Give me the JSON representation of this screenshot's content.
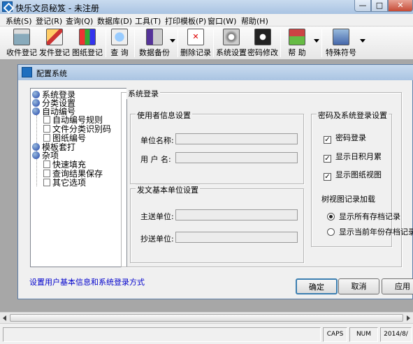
{
  "window": {
    "title": "快乐文员秘笈 - 未注册",
    "min": "—",
    "max": "□",
    "close": "✕"
  },
  "menu": [
    "系统(S)",
    "登记(R)",
    "查询(Q)",
    "数据库(D)",
    "工具(T)",
    "打印模板(P)",
    "窗口(W)",
    "帮助(H)"
  ],
  "toolbar": {
    "receive": "收件登记",
    "send": "发件登记",
    "drawing": "图纸登记",
    "query": "查 询",
    "backup": "数据备份",
    "delete": "删除记录",
    "settings": "系统设置",
    "password": "密码修改",
    "help": "帮 助",
    "symbols": "特殊符号"
  },
  "dialog": {
    "title": "配置系统",
    "tree": {
      "login": "系统登录",
      "category": "分类设置",
      "autonum": "自动编号",
      "autonum_rule": "自动编号规则",
      "file_classify": "文件分类识别码",
      "drawing_num": "图纸编号",
      "template": "模板套打",
      "misc": "杂项",
      "quickfill": "快速填充",
      "save_query": "查询结果保存",
      "other": "其它选项"
    },
    "hint": "设置用户基本信息和系统登录方式",
    "section_title": "系统登录",
    "user_group": {
      "title": "使用者信息设置",
      "unit_label": "单位名称:",
      "unit_value": "",
      "user_label": "用 户 名:",
      "user_value": ""
    },
    "send_group": {
      "title": "发文基本单位设置",
      "main_label": "主送单位:",
      "main_value": "",
      "cc_label": "抄送单位:",
      "cc_value": ""
    },
    "pwd_group": {
      "title": "密码及系统登录设置",
      "pwd_login": "密码登录",
      "show_calendar": "显示日积月累",
      "show_drawing": "显示图纸视图",
      "tree_load_label": "树视图记录加载",
      "show_all": "显示所有存档记录",
      "show_current_year": "显示当前年份存档记录"
    },
    "buttons": {
      "ok": "确定",
      "cancel": "取消",
      "apply": "应用"
    }
  },
  "status": {
    "caps": "CAPS",
    "num": "NUM",
    "date": "2014/8/"
  },
  "colors": {
    "accent": "#1f6fbf",
    "hint": "#0000cc"
  }
}
